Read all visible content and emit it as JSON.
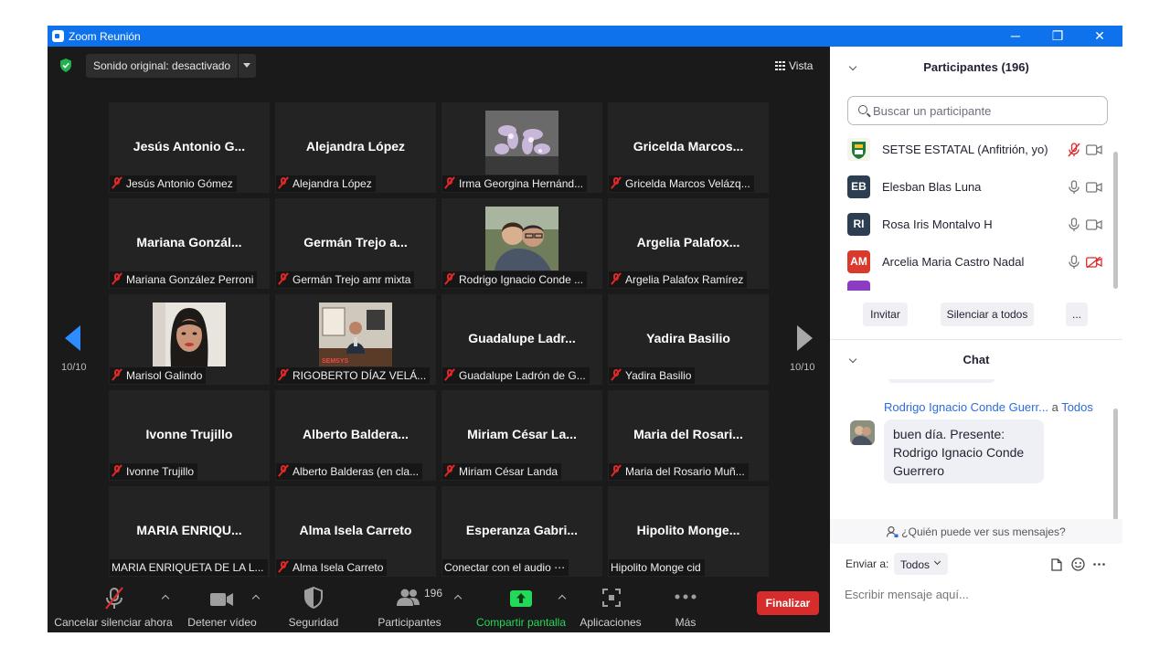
{
  "window": {
    "title": "Zoom Reunión",
    "minimize": "─",
    "restore": "❐",
    "close": "✕"
  },
  "topbar": {
    "sound_label": "Sonido original: desactivado",
    "view_label": "Vista"
  },
  "pager": {
    "left_page": "10/10",
    "right_page": "10/10"
  },
  "tiles": [
    {
      "big": "Jesús Antonio G...",
      "tag": "Jesús Antonio Gómez",
      "muted": true
    },
    {
      "big": "Alejandra López",
      "tag": "Alejandra López",
      "muted": true
    },
    {
      "big": "",
      "tag": "Irma Georgina Hernánd...",
      "muted": true,
      "photo": "flowers"
    },
    {
      "big": "Gricelda Marcos...",
      "tag": "Gricelda Marcos Velázq...",
      "muted": true
    },
    {
      "big": "Mariana Gonzál...",
      "tag": "Mariana González Perroni",
      "muted": true
    },
    {
      "big": "Germán Trejo a...",
      "tag": "Germán Trejo amr mixta",
      "muted": true
    },
    {
      "big": "",
      "tag": "Rodrigo Ignacio Conde ...",
      "muted": true,
      "photo": "couple"
    },
    {
      "big": "Argelia Palafox...",
      "tag": "Argelia Palafox Ramírez",
      "muted": true
    },
    {
      "big": "",
      "tag": "Marisol Galindo",
      "muted": true,
      "photo": "woman"
    },
    {
      "big": "",
      "tag": "RIGOBERTO DÍAZ VELÁ...",
      "muted": true,
      "photo": "office"
    },
    {
      "big": "Guadalupe Ladr...",
      "tag": "Guadalupe Ladrón de G...",
      "muted": true
    },
    {
      "big": "Yadira Basilio",
      "tag": "Yadira Basilio",
      "muted": true
    },
    {
      "big": "Ivonne Trujillo",
      "tag": "Ivonne Trujillo",
      "muted": true
    },
    {
      "big": "Alberto Baldera...",
      "tag": "Alberto Balderas (en cla...",
      "muted": true
    },
    {
      "big": "Miriam César La...",
      "tag": "Miriam César Landa",
      "muted": true
    },
    {
      "big": "Maria del Rosari...",
      "tag": "Maria del Rosario Muñ...",
      "muted": true
    },
    {
      "big": "MARIA ENRIQU...",
      "tag": "MARIA ENRIQUETA DE LA L...",
      "muted": false
    },
    {
      "big": "Alma Isela Carreto",
      "tag": "Alma Isela Carreto",
      "muted": true
    },
    {
      "big": "Esperanza Gabri...",
      "tag": "Conectar con el audio ⋯",
      "muted": false
    },
    {
      "big": "Hipolito Monge...",
      "tag": "Hipolito Monge cid",
      "muted": false
    }
  ],
  "toolbar": {
    "unmute": "Cancelar silenciar ahora",
    "video": "Detener vídeo",
    "security": "Seguridad",
    "participants": "Participantes",
    "participants_count": "196",
    "share": "Compartir pantalla",
    "apps": "Aplicaciones",
    "more": "Más",
    "end": "Finalizar"
  },
  "participants_panel": {
    "title": "Participantes (196)",
    "search_placeholder": "Buscar un participante",
    "list": [
      {
        "initials": "",
        "name": "SETSE ESTATAL (Anfitrión, yo)",
        "avatar_color": "#f2f2f2",
        "mic_muted": true,
        "cam_off": false
      },
      {
        "initials": "EB",
        "name": "Elesban Blas Luna",
        "avatar_color": "#2d3e50",
        "mic_muted": false,
        "cam_off": false
      },
      {
        "initials": "RI",
        "name": "Rosa Iris Montalvo H",
        "avatar_color": "#2d3e50",
        "mic_muted": false,
        "cam_off": false
      },
      {
        "initials": "AM",
        "name": "Arcelia Maria Castro Nadal",
        "avatar_color": "#d93a2b",
        "mic_muted": false,
        "cam_off": true
      }
    ],
    "buttons": {
      "invite": "Invitar",
      "mute_all": "Silenciar a todos",
      "more": "..."
    }
  },
  "chat_panel": {
    "title": "Chat",
    "message": {
      "sender": "Rodrigo Ignacio Conde Guerr...",
      "to_prefix": "a",
      "to_target": "Todos",
      "text": "buen día. Presente: Rodrigo Ignacio Conde Guerrero"
    },
    "who_can_see": "¿Quién puede ver sus mensajes?",
    "send_to_label": "Enviar a:",
    "send_to_value": "Todos",
    "input_placeholder": "Escribir mensaje aquí..."
  },
  "colors": {
    "accent": "#0e72ed",
    "end_red": "#d72c2c",
    "share_green": "#23d959",
    "link_blue": "#2d6cdf"
  }
}
